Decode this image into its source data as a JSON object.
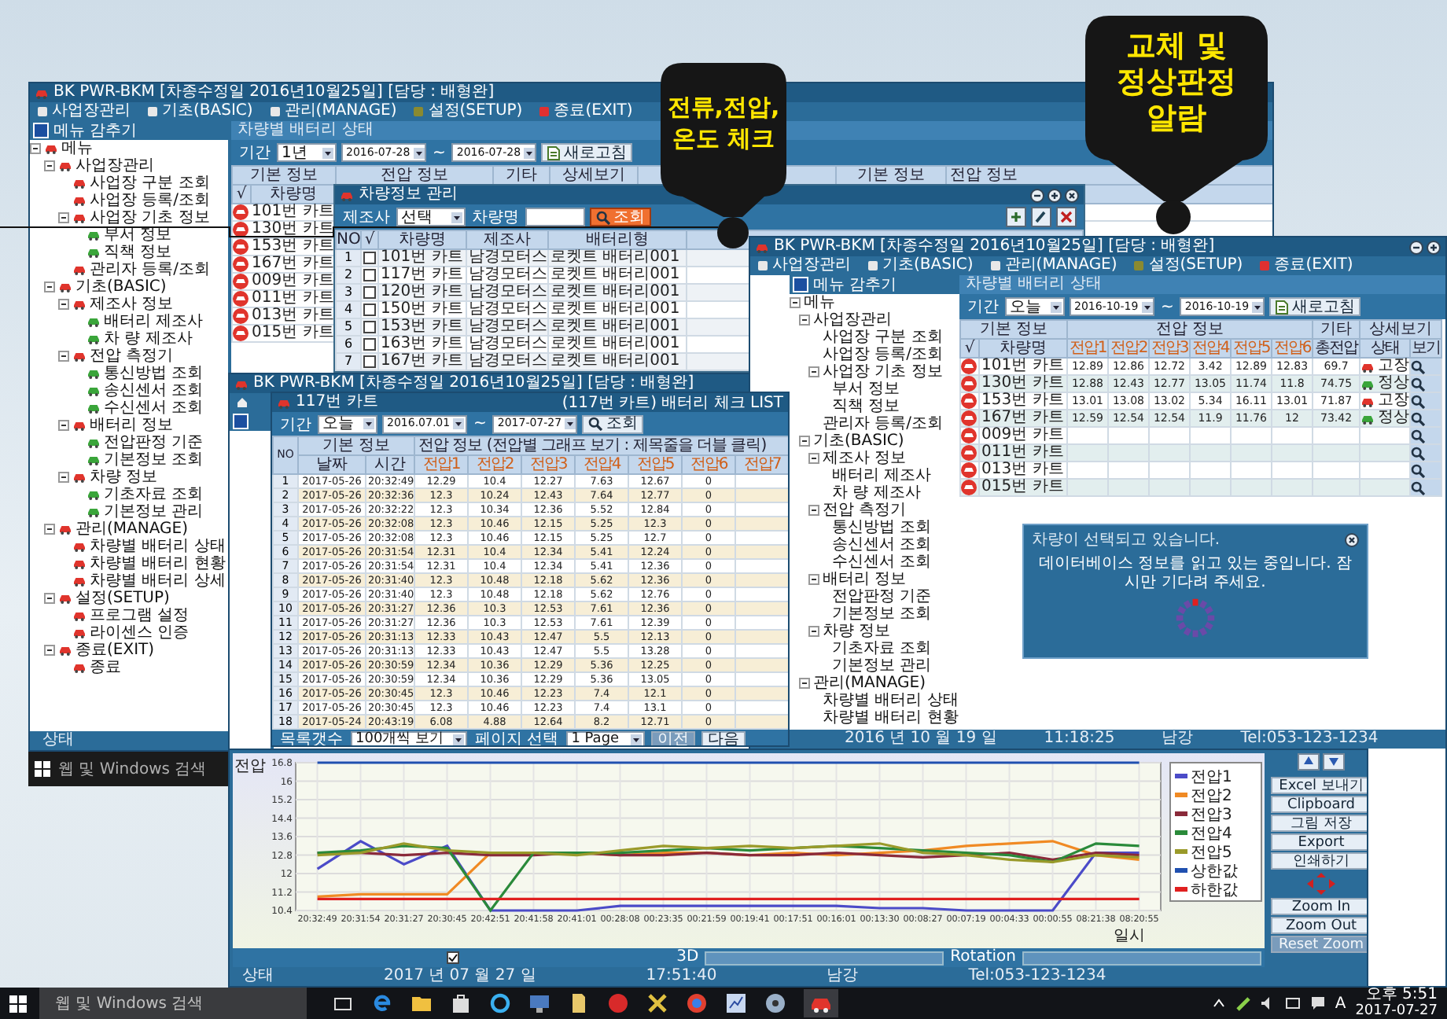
{
  "main_window": {
    "title": "BK PWR-BKM [차종수정일 2016년10월25일] [담당 : 배형완]",
    "menu": [
      "사업장관리",
      "기초(BASIC)",
      "관리(MANAGE)",
      "설정(SETUP)",
      "종료(EXIT)"
    ],
    "hide_menu": "메뉴 감추기",
    "tree": [
      {
        "label": "메뉴",
        "expanded": true,
        "children": [
          {
            "label": "사업장관리",
            "expanded": true,
            "children": [
              {
                "label": "사업장 구분 조회"
              },
              {
                "label": "사업장 등록/조회"
              },
              {
                "label": "사업장 기초 정보",
                "expanded": true,
                "children": [
                  {
                    "label": "부서 정보"
                  },
                  {
                    "label": "직책 정보"
                  }
                ]
              },
              {
                "label": "관리자 등록/조회"
              }
            ]
          },
          {
            "label": "기초(BASIC)",
            "expanded": true,
            "children": [
              {
                "label": "제조사 정보",
                "expanded": true,
                "children": [
                  {
                    "label": "배터리 제조사"
                  },
                  {
                    "label": "차 량 제조사"
                  }
                ]
              },
              {
                "label": "전압 측정기",
                "expanded": true,
                "children": [
                  {
                    "label": "통신방법 조회"
                  },
                  {
                    "label": "송신센서 조회"
                  },
                  {
                    "label": "수신센서 조회"
                  }
                ]
              },
              {
                "label": "배터리 정보",
                "expanded": true,
                "children": [
                  {
                    "label": "전압판정 기준"
                  },
                  {
                    "label": "기본정보 조회"
                  }
                ]
              },
              {
                "label": "차량 정보",
                "expanded": true,
                "children": [
                  {
                    "label": "기초자료 조회"
                  },
                  {
                    "label": "기본정보 관리"
                  }
                ]
              }
            ]
          },
          {
            "label": "관리(MANAGE)",
            "expanded": true,
            "children": [
              {
                "label": "차량별 배터리 상태"
              },
              {
                "label": "차량별 배터리 현황"
              },
              {
                "label": "차량별 배터리 상세"
              }
            ]
          },
          {
            "label": "설정(SETUP)",
            "expanded": true,
            "children": [
              {
                "label": "프로그램 설정"
              },
              {
                "label": "라이센스 인증"
              }
            ]
          },
          {
            "label": "종료(EXIT)",
            "expanded": true,
            "children": [
              {
                "label": "종료"
              }
            ]
          }
        ]
      }
    ],
    "panel_title": "차량별 배터리 상태",
    "period_label": "기간",
    "period": "1년",
    "date_from": "2016-07-28",
    "range_sep": "~",
    "date_to": "2016-07-28",
    "refresh": "새로고침",
    "group_headers": [
      "기본 정보",
      "전압 정보",
      "기타",
      "상세보기",
      "기본 정보",
      "전압 정보"
    ],
    "sub_headers": [
      "√",
      "차량명"
    ],
    "cars": [
      "101번 카트",
      "130번 카트",
      "153번 카트",
      "167번 카트",
      "009번 카트",
      "011번 카트",
      "013번 카트",
      "015번 카트"
    ],
    "status": "상태"
  },
  "vehicle_dialog": {
    "title": "차량정보 관리",
    "maker_label": "제조사",
    "maker": "선택",
    "name_label": "차량명",
    "search": "조회",
    "columns": [
      "NO",
      "√",
      "차량명",
      "제조사",
      "배터리형"
    ],
    "rows": [
      {
        "no": "1",
        "checked": false,
        "name": "101번 카트",
        "maker": "남경모터스",
        "battery": "로켓트 배터리001"
      },
      {
        "no": "2",
        "checked": false,
        "name": "117번 카트",
        "maker": "남경모터스",
        "battery": "로켓트 배터리001"
      },
      {
        "no": "3",
        "checked": false,
        "name": "120번 카트",
        "maker": "남경모터스",
        "battery": "로켓트 배터리001"
      },
      {
        "no": "4",
        "checked": false,
        "name": "150번 카트",
        "maker": "남경모터스",
        "battery": "로켓트 배터리001"
      },
      {
        "no": "5",
        "checked": false,
        "name": "153번 카트",
        "maker": "남경모터스",
        "battery": "로켓트 배터리001"
      },
      {
        "no": "6",
        "checked": false,
        "name": "163번 카트",
        "maker": "남경모터스",
        "battery": "로켓트 배터리001"
      },
      {
        "no": "7",
        "checked": false,
        "name": "167번 카트",
        "maker": "남경모터스",
        "battery": "로켓트 배터리001"
      }
    ]
  },
  "back_window": {
    "title": "BK PWR-BKM [차종수정일 2016년10월25일] [담당 : 배형완]"
  },
  "list_window": {
    "title": "117번 카트",
    "period_label": "기간",
    "period": "오늘",
    "date_from": "2016.07.01",
    "range_sep": "~",
    "date_to": "2017-07-27",
    "search": "조회",
    "list_title": "(117번 카트) 배터리 체크 LIST",
    "group_headers": [
      "기본 정보",
      "전압 정보 (전압별 그래프 보기 : 제목줄을 더블 클릭)"
    ],
    "columns": [
      "NO",
      "날짜",
      "시간",
      "전압1",
      "전압2",
      "전압3",
      "전압4",
      "전압5",
      "전압6",
      "전압7"
    ],
    "rows": [
      [
        "1",
        "2017-05-26",
        "20:32:49",
        "12.29",
        "10.4",
        "12.27",
        "7.63",
        "12.67",
        "0"
      ],
      [
        "2",
        "2017-05-26",
        "20:32:36",
        "12.3",
        "10.24",
        "12.43",
        "7.64",
        "12.77",
        "0"
      ],
      [
        "3",
        "2017-05-26",
        "20:32:22",
        "12.3",
        "10.34",
        "12.36",
        "5.52",
        "12.84",
        "0"
      ],
      [
        "4",
        "2017-05-26",
        "20:32:08",
        "12.3",
        "10.46",
        "12.15",
        "5.25",
        "12.3",
        "0"
      ],
      [
        "5",
        "2017-05-26",
        "20:32:08",
        "12.3",
        "10.46",
        "12.15",
        "5.25",
        "12.7",
        "0"
      ],
      [
        "6",
        "2017-05-26",
        "20:31:54",
        "12.31",
        "10.4",
        "12.34",
        "5.41",
        "12.24",
        "0"
      ],
      [
        "7",
        "2017-05-26",
        "20:31:54",
        "12.31",
        "10.4",
        "12.34",
        "5.41",
        "12.36",
        "0"
      ],
      [
        "8",
        "2017-05-26",
        "20:31:40",
        "12.3",
        "10.48",
        "12.18",
        "5.62",
        "12.36",
        "0"
      ],
      [
        "9",
        "2017-05-26",
        "20:31:40",
        "12.3",
        "10.48",
        "12.18",
        "5.62",
        "12.76",
        "0"
      ],
      [
        "10",
        "2017-05-26",
        "20:31:27",
        "12.36",
        "10.3",
        "12.53",
        "7.61",
        "12.36",
        "0"
      ],
      [
        "11",
        "2017-05-26",
        "20:31:27",
        "12.36",
        "10.3",
        "12.53",
        "7.61",
        "12.39",
        "0"
      ],
      [
        "12",
        "2017-05-26",
        "20:31:13",
        "12.33",
        "10.43",
        "12.47",
        "5.5",
        "12.13",
        "0"
      ],
      [
        "13",
        "2017-05-26",
        "20:31:13",
        "12.33",
        "10.43",
        "12.47",
        "5.5",
        "13.28",
        "0"
      ],
      [
        "14",
        "2017-05-26",
        "20:30:59",
        "12.34",
        "10.36",
        "12.29",
        "5.36",
        "12.25",
        "0"
      ],
      [
        "15",
        "2017-05-26",
        "20:30:59",
        "12.34",
        "10.36",
        "12.29",
        "5.36",
        "13.05",
        "0"
      ],
      [
        "16",
        "2017-05-26",
        "20:30:45",
        "12.3",
        "10.46",
        "12.23",
        "7.4",
        "12.1",
        "0"
      ],
      [
        "17",
        "2017-05-26",
        "20:30:45",
        "12.3",
        "10.46",
        "12.23",
        "7.4",
        "13.1",
        "0"
      ],
      [
        "18",
        "2017-05-24",
        "20:43:19",
        "6.08",
        "4.88",
        "12.64",
        "8.2",
        "12.71",
        "0"
      ]
    ],
    "count_label": "목록갯수",
    "count": "100개씩 보기",
    "page_label": "페이지 선택",
    "page": "1 Page",
    "pager": [
      {
        "label": "이전",
        "disabled": true
      },
      {
        "label": "다음",
        "disabled": false
      }
    ]
  },
  "status_window": {
    "title": "BK PWR-BKM [차종수정일 2016년10월25일] [담당 : 배형완]",
    "menu": [
      "사업장관리",
      "기초(BASIC)",
      "관리(MANAGE)",
      "설정(SETUP)",
      "종료(EXIT)"
    ],
    "hide_menu": "메뉴 감추기",
    "tree": [
      {
        "label": "메뉴",
        "expanded": true,
        "children": [
          {
            "label": "사업장관리",
            "expanded": true,
            "children": [
              {
                "label": "사업장 구분 조회"
              },
              {
                "label": "사업장 등록/조회"
              },
              {
                "label": "사업장 기초 정보",
                "expanded": true,
                "children": [
                  {
                    "label": "부서 정보"
                  },
                  {
                    "label": "직책 정보"
                  }
                ]
              },
              {
                "label": "관리자 등록/조회"
              }
            ]
          },
          {
            "label": "기초(BASIC)",
            "expanded": true,
            "children": [
              {
                "label": "제조사 정보",
                "expanded": true,
                "children": [
                  {
                    "label": "배터리 제조사"
                  },
                  {
                    "label": "차 량 제조사"
                  }
                ]
              },
              {
                "label": "전압 측정기",
                "expanded": true,
                "children": [
                  {
                    "label": "통신방법 조회"
                  },
                  {
                    "label": "송신센서 조회"
                  },
                  {
                    "label": "수신센서 조회"
                  }
                ]
              },
              {
                "label": "배터리 정보",
                "expanded": true,
                "children": [
                  {
                    "label": "전압판정 기준"
                  },
                  {
                    "label": "기본정보 조회"
                  }
                ]
              },
              {
                "label": "차량 정보",
                "expanded": true,
                "children": [
                  {
                    "label": "기초자료 조회"
                  },
                  {
                    "label": "기본정보 관리"
                  }
                ]
              }
            ]
          },
          {
            "label": "관리(MANAGE)",
            "expanded": true,
            "children": [
              {
                "label": "차량별 배터리 상태"
              },
              {
                "label": "차량별 배터리 현황"
              }
            ]
          }
        ]
      }
    ],
    "panel_title": "차량별 배터리 상태",
    "period_label": "기간",
    "period": "오늘",
    "date_from": "2016-10-19",
    "range_sep": "~",
    "date_to": "2016-10-19",
    "refresh": "새로고침",
    "group_headers": [
      "기본 정보",
      "전압 정보",
      "기타",
      "상세보기"
    ],
    "columns": [
      "√",
      "차량명",
      "전압1",
      "전압2",
      "전압3",
      "전압4",
      "전압5",
      "전압6",
      "총전압",
      "상태",
      "보기"
    ],
    "rows": [
      {
        "name": "101번 카트",
        "volts": [
          "12.89",
          "12.86",
          "12.72",
          "3.42",
          "12.89",
          "12.83"
        ],
        "total": "69.7",
        "status": "고장",
        "alarm": true
      },
      {
        "name": "130번 카트",
        "volts": [
          "12.88",
          "12.43",
          "12.77",
          "13.05",
          "11.74",
          "11.8"
        ],
        "total": "74.75",
        "status": "정상",
        "alarm": false
      },
      {
        "name": "153번 카트",
        "volts": [
          "13.01",
          "13.08",
          "13.02",
          "5.34",
          "16.11",
          "13.01"
        ],
        "total": "71.87",
        "status": "고장",
        "alarm": true
      },
      {
        "name": "167번 카트",
        "volts": [
          "12.59",
          "12.54",
          "12.54",
          "11.9",
          "11.76",
          "12"
        ],
        "total": "73.42",
        "status": "정상",
        "alarm": false
      },
      {
        "name": "009번 카트"
      },
      {
        "name": "011번 카트"
      },
      {
        "name": "013번 카트"
      },
      {
        "name": "015번 카트"
      }
    ],
    "loading": {
      "title": "차량이 선택되고 있습니다.",
      "message": "데이터베이스 정보를 읽고 있는 중입니다. 잠시만 기다려 주세요."
    },
    "status": [
      "2016 년 10 월 19 일",
      "11:18:25",
      "남강",
      "Tel:053-123-1234"
    ]
  },
  "chart_window": {
    "chart_data": {
      "type": "line",
      "ylabel": "전압",
      "xlabel": "일시",
      "grid": true,
      "legend": "right",
      "categories": [
        "20:32:49",
        "20:31:54",
        "20:31:27",
        "20:30:45",
        "20:42:51",
        "20:41:58",
        "20:41:01",
        "00:28:08",
        "00:23:35",
        "00:21:59",
        "00:19:41",
        "00:17:51",
        "00:16:01",
        "00:13:30",
        "00:08:27",
        "00:07:19",
        "00:04:33",
        "00:00:55",
        "08:21:38",
        "08:20:55"
      ],
      "ylim": [
        10.4,
        16.8
      ],
      "yticks": [
        10.4,
        11.2,
        12,
        12.8,
        13.6,
        14.4,
        15.2,
        16,
        16.8
      ],
      "series": [
        {
          "name": "전압1",
          "color": "#4b4bc8",
          "values": [
            12.2,
            13.4,
            12.4,
            13.2,
            10.4,
            10.4,
            10.4,
            10.6,
            10.6,
            10.6,
            10.6,
            10.6,
            10.6,
            10.5,
            10.5,
            10.4,
            10.4,
            10.4,
            12.9,
            12.9
          ]
        },
        {
          "name": "전압2",
          "color": "#f08a24",
          "values": [
            11.0,
            11.1,
            11.1,
            11.1,
            12.9,
            12.9,
            12.9,
            12.8,
            12.9,
            12.9,
            12.8,
            12.9,
            12.8,
            12.9,
            13.0,
            13.2,
            13.3,
            13.4,
            12.8,
            12.6
          ]
        },
        {
          "name": "전압3",
          "color": "#8a2a3a",
          "values": [
            12.9,
            12.9,
            12.8,
            12.9,
            12.8,
            12.8,
            12.9,
            12.8,
            12.8,
            12.9,
            12.8,
            12.8,
            12.9,
            12.8,
            12.7,
            12.8,
            12.9,
            12.6,
            12.9,
            12.8
          ]
        },
        {
          "name": "전압4",
          "color": "#2a8a3a",
          "values": [
            12.9,
            13.0,
            13.2,
            13.1,
            10.4,
            12.9,
            12.9,
            12.9,
            13.0,
            13.1,
            13.0,
            13.1,
            13.2,
            13.1,
            13.0,
            12.9,
            12.8,
            12.5,
            13.3,
            13.2
          ]
        },
        {
          "name": "전압5",
          "color": "#9a9a2a",
          "values": [
            12.8,
            12.9,
            13.3,
            13.0,
            12.9,
            12.9,
            12.8,
            13.0,
            13.2,
            13.1,
            13.2,
            13.1,
            13.2,
            13.3,
            12.9,
            12.8,
            12.6,
            12.5,
            12.8,
            12.7
          ]
        },
        {
          "name": "상한값",
          "color": "#2050b0",
          "values": [
            16.8,
            16.8,
            16.8,
            16.8,
            16.8,
            16.8,
            16.8,
            16.8,
            16.8,
            16.8,
            16.8,
            16.8,
            16.8,
            16.8,
            16.8,
            16.8,
            16.8,
            16.8,
            16.8,
            16.8
          ]
        },
        {
          "name": "하한값",
          "color": "#e02020",
          "values": [
            10.9,
            10.9,
            10.9,
            10.9,
            10.9,
            10.9,
            10.9,
            10.9,
            10.9,
            10.9,
            10.9,
            10.9,
            10.9,
            10.9,
            10.9,
            10.9,
            10.9,
            10.9,
            10.9,
            10.9
          ]
        }
      ]
    },
    "view_3d": {
      "label": "3D",
      "checked": true
    },
    "rotation_label": "Rotation",
    "buttons": [
      "Excel 보내기",
      "Clipboard",
      "그림 저장",
      "Export",
      "인쇄하기"
    ],
    "zoom_buttons": [
      {
        "label": "Zoom In",
        "disabled": false
      },
      {
        "label": "Zoom Out",
        "disabled": false
      },
      {
        "label": "Reset Zoom",
        "disabled": true
      }
    ],
    "status": [
      "상태",
      "2017 년 07 월 27 일",
      "17:51:40",
      "남강",
      "Tel:053-123-1234"
    ]
  },
  "left_taskbar": {
    "search": "웹 및 Windows 검색"
  },
  "taskbar": {
    "search": "웹 및 Windows 검색",
    "ime": "A",
    "time": "오후 5:51",
    "date": "2017-07-27"
  },
  "callouts": [
    {
      "lines": [
        "교체 및",
        "정상판정",
        "알람"
      ]
    },
    {
      "lines": [
        "전류,전압,",
        "온도 체크"
      ]
    }
  ]
}
